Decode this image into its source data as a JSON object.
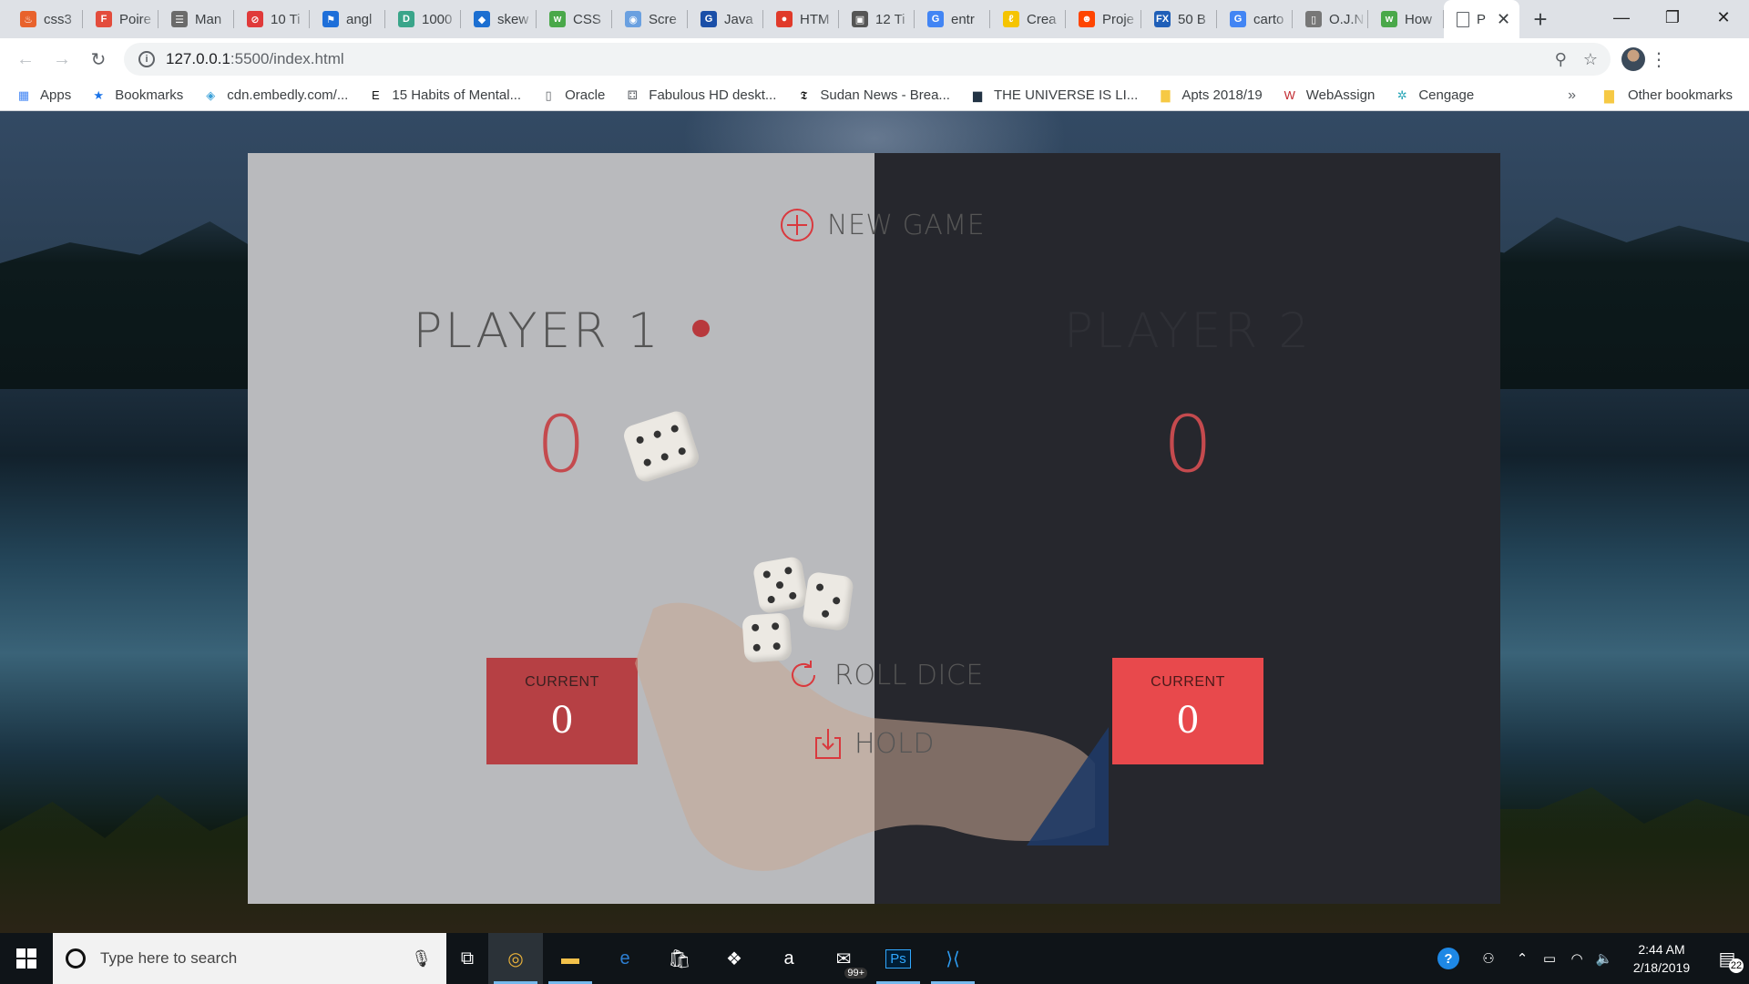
{
  "browser": {
    "tabs": [
      {
        "label": "css3",
        "color": "#e8622c",
        "glyph": "♨"
      },
      {
        "label": "Poire",
        "color": "#e34c3c",
        "glyph": "F"
      },
      {
        "label": "Man",
        "color": "#6b6b6b",
        "glyph": "☰"
      },
      {
        "label": "10 Ti",
        "color": "#e03a3a",
        "glyph": "⊘"
      },
      {
        "label": "angl",
        "color": "#1e6fd9",
        "glyph": "⚑"
      },
      {
        "label": "1000",
        "color": "#3aa58a",
        "glyph": "D"
      },
      {
        "label": "skew",
        "color": "#1c6fd1",
        "glyph": "◆"
      },
      {
        "label": "CSS",
        "color": "#4aa84a",
        "glyph": "w"
      },
      {
        "label": "Scre",
        "color": "#6aa0e0",
        "glyph": "◉"
      },
      {
        "label": "Java",
        "color": "#1a4fa8",
        "glyph": "G"
      },
      {
        "label": "HTM",
        "color": "#e03a2a",
        "glyph": "●"
      },
      {
        "label": "12 Ti",
        "color": "#555555",
        "glyph": "▣"
      },
      {
        "label": "entr",
        "color": "#4285f4",
        "glyph": "G"
      },
      {
        "label": "Crea",
        "color": "#f5c400",
        "glyph": "ℓ"
      },
      {
        "label": "Proje",
        "color": "#ff4500",
        "glyph": "☻"
      },
      {
        "label": "50 B",
        "color": "#1f5fb8",
        "glyph": "FX"
      },
      {
        "label": "carto",
        "color": "#4285f4",
        "glyph": "G"
      },
      {
        "label": "O.J.N",
        "color": "#777777",
        "glyph": "▯"
      },
      {
        "label": "How",
        "color": "#4aa84a",
        "glyph": "w"
      }
    ],
    "active_tab": {
      "label": "P",
      "close": "✕"
    },
    "new_tab": "+",
    "window_controls": {
      "minimize": "—",
      "maximize": "❐",
      "close": "✕"
    },
    "address": {
      "host": "127.0.0.1",
      "path": ":5500/index.html",
      "info": "i"
    },
    "nav": {
      "back": "←",
      "forward": "→",
      "reload": "↻"
    },
    "omni_icons": {
      "zoom": "⚲",
      "star": "☆"
    },
    "menu": "⋮",
    "bookmarks": [
      {
        "label": "Apps",
        "icon": "apps-grid-icon",
        "glyph": "▦",
        "color": "#4285f4"
      },
      {
        "label": "Bookmarks",
        "icon": "star-icon",
        "glyph": "★",
        "color": "#1a73e8"
      },
      {
        "label": "cdn.embedly.com/...",
        "icon": "embedly-icon",
        "glyph": "◈",
        "color": "#3aa0d8"
      },
      {
        "label": "15 Habits of Mental...",
        "icon": "e-icon",
        "glyph": "E",
        "color": "#111111"
      },
      {
        "label": "Oracle",
        "icon": "page-icon",
        "glyph": "▯",
        "color": "#5f6368"
      },
      {
        "label": "Fabulous HD deskt...",
        "icon": "wallpaper-icon",
        "glyph": "⚃",
        "color": "#5f6368"
      },
      {
        "label": "Sudan News - Brea...",
        "icon": "nyt-icon",
        "glyph": "𝕿",
        "color": "#111111"
      },
      {
        "label": "THE UNIVERSE IS LI...",
        "icon": "thumbnail-icon",
        "glyph": "▆",
        "color": "#223344"
      },
      {
        "label": "Apts 2018/19",
        "icon": "folder-icon",
        "glyph": "▇",
        "color": "#f6c944"
      },
      {
        "label": "WebAssign",
        "icon": "webassign-icon",
        "glyph": "W",
        "color": "#c1272d"
      },
      {
        "label": "Cengage",
        "icon": "cengage-icon",
        "glyph": "✲",
        "color": "#2aa7b8"
      }
    ],
    "bookmarks_more": "»",
    "other_bookmarks": "Other bookmarks"
  },
  "game": {
    "new_game": "NEW GAME",
    "roll_dice": "ROLL DICE",
    "hold": "HOLD",
    "player1": {
      "name": "PLAYER 1",
      "score": "0",
      "current_label": "CURRENT",
      "current": "0",
      "active": true
    },
    "player2": {
      "name": "PLAYER 2",
      "score": "0",
      "current_label": "CURRENT",
      "current": "0",
      "active": false
    },
    "colors": {
      "accent": "#eb4d4d",
      "left_panel": "#b9babd",
      "right_panel": "#26272d"
    }
  },
  "taskbar": {
    "search_placeholder": "Type here to search",
    "apps": [
      {
        "name": "task-view",
        "glyph": "⧉"
      },
      {
        "name": "chrome",
        "glyph": "◎"
      },
      {
        "name": "file-explorer",
        "glyph": "▬"
      },
      {
        "name": "edge",
        "glyph": "e"
      },
      {
        "name": "store",
        "glyph": "🛍"
      },
      {
        "name": "dropbox",
        "glyph": "❖"
      },
      {
        "name": "amazon",
        "glyph": "a"
      },
      {
        "name": "mail",
        "glyph": "✉",
        "badge": "99+"
      },
      {
        "name": "photoshop",
        "glyph": "Ps"
      },
      {
        "name": "vscode",
        "glyph": "⟩⟨"
      }
    ],
    "clock": {
      "time": "2:44 AM",
      "date": "2/18/2019"
    },
    "notifications": "22"
  }
}
